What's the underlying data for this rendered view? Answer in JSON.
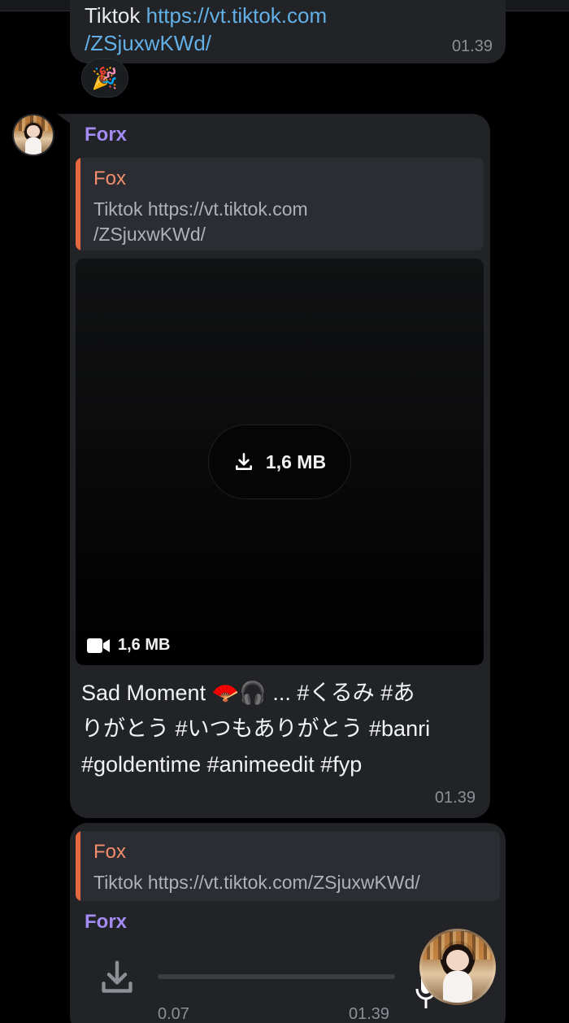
{
  "message1": {
    "text_prefix": "Tiktok ",
    "link_line1": "https://vt.tiktok.com",
    "link_line2": "/ZSjuxwKWd/",
    "time": "01.39",
    "reaction": "🎉"
  },
  "message2": {
    "sender": "Forx",
    "quote": {
      "name": "Fox",
      "line1": "Tiktok https://vt.tiktok.com",
      "line2": "/ZSjuxwKWd/"
    },
    "video": {
      "download_size": "1,6 MB",
      "file_size": "1,6 MB"
    },
    "caption_line1": "Sad Moment 🪭🎧 ... #くるみ #あ",
    "caption_line2": "りがとう #いつもありがとう #banri",
    "caption_line3": "#goldentime #animeedit #fyp",
    "time": "01.39"
  },
  "message3": {
    "quote": {
      "name": "Fox",
      "text": "Tiktok https://vt.tiktok.com/ZSjuxwKWd/"
    },
    "sender": "Forx",
    "audio_duration": "0.07",
    "time": "01.39"
  },
  "colors": {
    "background": "#000000",
    "bubble": "#212327",
    "sender": "#a48bf3",
    "quote_bar": "#e5683e",
    "quote_name": "#f28d6c",
    "link": "#62b0e6"
  }
}
